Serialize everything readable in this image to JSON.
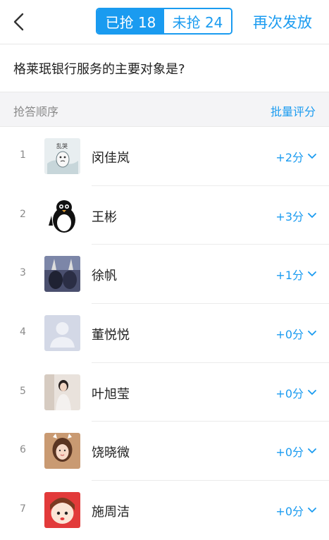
{
  "header": {
    "back_icon": "chevron-left-icon",
    "tabs": [
      {
        "label": "已抢 18",
        "active": true
      },
      {
        "label": "未抢 24",
        "active": false
      }
    ],
    "resend_label": "再次发放"
  },
  "question": "格莱珉银行服务的主要对象是?",
  "section": {
    "label": "抢答顺序",
    "batch_label": "批量评分"
  },
  "participants": [
    {
      "rank": "1",
      "name": "闵佳岚",
      "score": "+2分",
      "avatar": "meme-sticker",
      "avatar_text": "乱哭"
    },
    {
      "rank": "2",
      "name": "王彬",
      "score": "+3分",
      "avatar": "penguin"
    },
    {
      "rank": "3",
      "name": "徐帆",
      "score": "+1分",
      "avatar": "photo-dark"
    },
    {
      "rank": "4",
      "name": "董悦悦",
      "score": "+0分",
      "avatar": "default-avatar"
    },
    {
      "rank": "5",
      "name": "叶旭莹",
      "score": "+0分",
      "avatar": "photo-girl"
    },
    {
      "rank": "6",
      "name": "饶晓微",
      "score": "+0分",
      "avatar": "photo-selfie"
    },
    {
      "rank": "7",
      "name": "施周洁",
      "score": "+0分",
      "avatar": "cartoon-girl"
    }
  ],
  "colors": {
    "accent": "#1a9bf0",
    "section_bg": "#f4f4f6",
    "muted": "#8a8a8a"
  }
}
